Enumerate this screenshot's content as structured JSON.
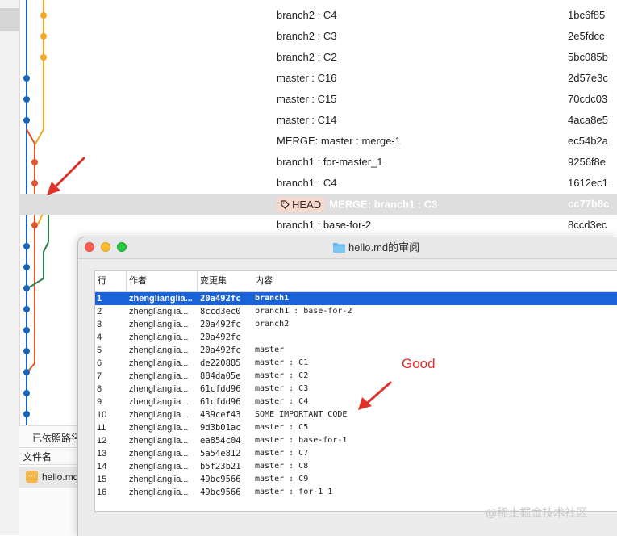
{
  "commits": [
    {
      "message": "branch2 : C4",
      "hash": "1bc6f85"
    },
    {
      "message": "branch2 : C3",
      "hash": "2e5fdcc"
    },
    {
      "message": "branch2 : C2",
      "hash": "5bc085b"
    },
    {
      "message": "master : C16",
      "hash": "2d57e3c"
    },
    {
      "message": "master : C15",
      "hash": "70cdc03"
    },
    {
      "message": "master : C14",
      "hash": "4aca8e5"
    },
    {
      "message": "MERGE: master : merge-1",
      "hash": "ec54b2a"
    },
    {
      "message": "branch1 : for-master_1",
      "hash": "9256f8e"
    },
    {
      "message": "branch1 : C4",
      "hash": "1612ec1"
    },
    {
      "message": "MERGE: branch1 : C3",
      "hash": "cc77b8c",
      "tag": "HEAD",
      "selected": true
    },
    {
      "message": "branch1 : base-for-2",
      "hash": "8ccd3ec"
    }
  ],
  "left_panel": {
    "path_text": "已依照路径",
    "file_header": "文件名",
    "file_name": "hello.md",
    "file_icon": "markdown-file-icon"
  },
  "blame_window": {
    "title": "hello.md的审阅",
    "title_icon": "folder-icon",
    "columns": {
      "line": "行",
      "author": "作者",
      "changeset": "变更集",
      "content": "内容"
    },
    "rows": [
      {
        "line": "1",
        "author": "zhenglianglia...",
        "changeset": "20a492fc",
        "content": "branch1",
        "selected": true
      },
      {
        "line": "2",
        "author": "zhenglianglia...",
        "changeset": "8ccd3ec0",
        "content": "branch1 : base-for-2"
      },
      {
        "line": "3",
        "author": "zhenglianglia...",
        "changeset": "20a492fc",
        "content": "branch2"
      },
      {
        "line": "4",
        "author": "zhenglianglia...",
        "changeset": "20a492fc",
        "content": ""
      },
      {
        "line": "5",
        "author": "zhenglianglia...",
        "changeset": "20a492fc",
        "content": "master"
      },
      {
        "line": "6",
        "author": "zhenglianglia...",
        "changeset": "de220885",
        "content": "master : C1"
      },
      {
        "line": "7",
        "author": "zhenglianglia...",
        "changeset": "884da05e",
        "content": "master : C2"
      },
      {
        "line": "8",
        "author": "zhenglianglia...",
        "changeset": "61cfdd96",
        "content": "master : C3"
      },
      {
        "line": "9",
        "author": "zhenglianglia...",
        "changeset": "61cfdd96",
        "content": "master : C4"
      },
      {
        "line": "10",
        "author": "zhenglianglia...",
        "changeset": "439cef43",
        "content": "SOME IMPORTANT CODE"
      },
      {
        "line": "11",
        "author": "zhenglianglia...",
        "changeset": "9d3b01ac",
        "content": "master : C5"
      },
      {
        "line": "12",
        "author": "zhenglianglia...",
        "changeset": "ea854c04",
        "content": "master : base-for-1"
      },
      {
        "line": "13",
        "author": "zhenglianglia...",
        "changeset": "5a54e812",
        "content": "master : C7"
      },
      {
        "line": "14",
        "author": "zhenglianglia...",
        "changeset": "b5f23b21",
        "content": "master : C8"
      },
      {
        "line": "15",
        "author": "zhenglianglia...",
        "changeset": "49bc9566",
        "content": "master : C9"
      },
      {
        "line": "16",
        "author": "zhenglianglia...",
        "changeset": "49bc9566",
        "content": "master : for-1_1"
      }
    ]
  },
  "annotations": {
    "good_label": "Good",
    "color": "#e0302a"
  },
  "watermark": "@稀土掘金技术社区",
  "colors": {
    "selection": "#1a62d8",
    "master_line": "#1565c0",
    "branch2_line": "#f5a623",
    "branch1_line": "#e0552a",
    "merge_line": "#2e7d4f"
  }
}
